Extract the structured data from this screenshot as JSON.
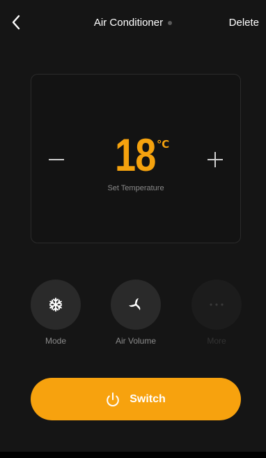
{
  "header": {
    "title": "Air Conditioner",
    "delete_label": "Delete"
  },
  "temperature": {
    "value": "18",
    "unit": "℃",
    "label": "Set Temperature"
  },
  "controls": [
    {
      "label": "Mode",
      "icon": "snowflake-icon",
      "enabled": true
    },
    {
      "label": "Air Volume",
      "icon": "fan-icon",
      "enabled": true
    },
    {
      "label": "More",
      "icon": "more-icon",
      "enabled": false
    }
  ],
  "switch": {
    "label": "Switch",
    "icon": "power-icon"
  },
  "colors": {
    "accent": "#f5a20e",
    "background": "#151515",
    "panel_border": "#2b2b2b"
  }
}
